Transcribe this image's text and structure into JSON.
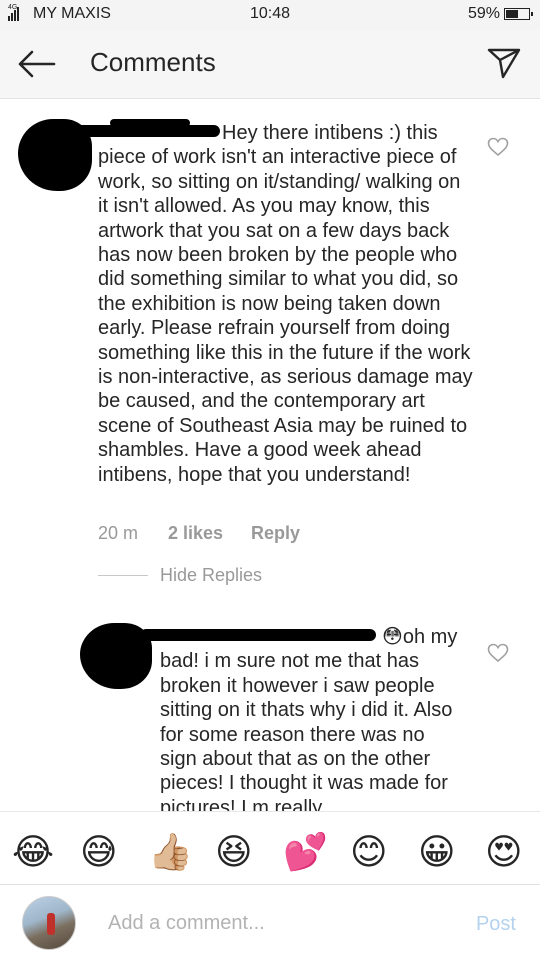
{
  "status_bar": {
    "network_tag": "4G",
    "carrier": "MY MAXIS",
    "time": "10:48",
    "battery_text": "59%",
    "battery_level": 0.59
  },
  "header": {
    "title": "Comments"
  },
  "comments": [
    {
      "text": "Hey there intibens :) this piece of work isn't an interactive piece of work, so sitting on it/standing/ walking on it isn't allowed. As you may know, this artwork that you sat on a few days back has now been broken by the people who did something similar to what you did, so the exhibition is now being taken down early. Please refrain yourself from doing something like this in the future if the work is non-interactive, as serious damage may be caused, and the contemporary art scene of Southeast Asia may be ruined to shambles. Have a good week ahead intibens, hope that you understand!",
      "time": "20 m",
      "likes": "2 likes",
      "reply": "Reply"
    }
  ],
  "hide_replies": "Hide Replies",
  "reply": {
    "text": "😳oh my bad! i m sure not me that has broken it however i saw people sitting on it thats why i did it. Also for some reason there was no sign about that as on the other pieces! I thought it was made for pictures! I m really"
  },
  "emoji_bar": [
    "😂",
    "😅",
    "👍🏼",
    "😆",
    "💕",
    "😊",
    "😀",
    "😍"
  ],
  "input": {
    "placeholder": "Add a comment...",
    "post_label": "Post"
  }
}
